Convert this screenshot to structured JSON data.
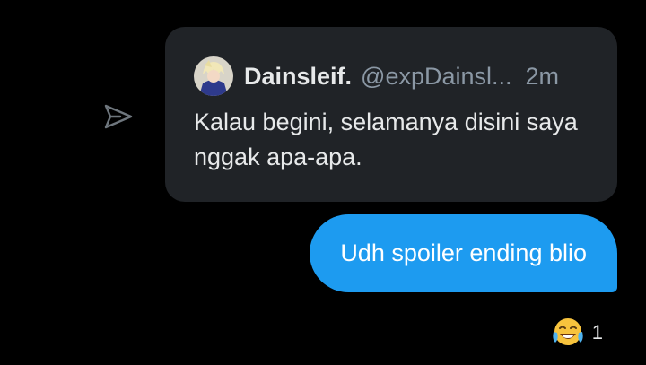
{
  "quoted_post": {
    "author_name": "Dainsleif.",
    "author_handle": "@expDainsl...",
    "time_ago": "2m",
    "separator": "·",
    "text": "Kalau begini, selamanya disini saya nggak apa-apa."
  },
  "message": {
    "text": "Udh spoiler ending blio"
  },
  "reaction": {
    "emoji": "😂",
    "count": "1"
  },
  "icons": {
    "share": "send-icon",
    "avatar": "avatar-image"
  },
  "colors": {
    "background": "#000000",
    "card": "#202327",
    "bubble": "#1d9bf0",
    "muted": "#8b98a5"
  }
}
